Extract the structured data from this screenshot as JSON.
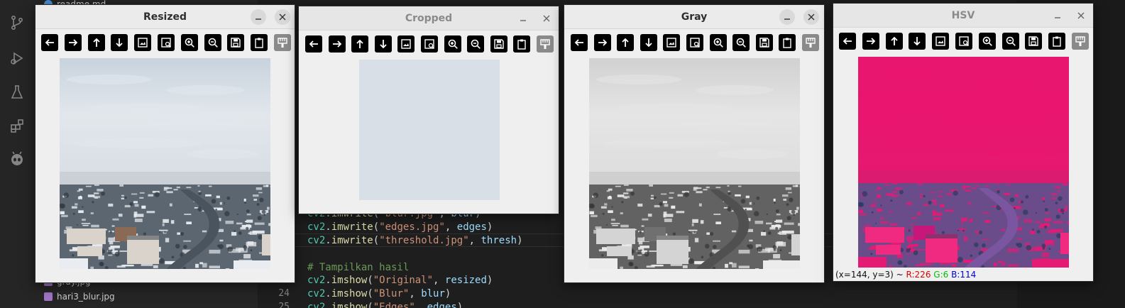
{
  "explorer": {
    "files": [
      {
        "name": "readme.md",
        "type": "md"
      },
      {
        "name": "gray.jpg",
        "type": "image"
      },
      {
        "name": "hari3_blur.jpg",
        "type": "image"
      }
    ]
  },
  "editor": {
    "lines": [
      {
        "number": "",
        "tokens": [
          {
            "t": "cv2",
            "c": "mod"
          },
          {
            "t": ".",
            "c": "pun"
          },
          {
            "t": "imwrite",
            "c": "fn"
          },
          {
            "t": "(",
            "c": "pun"
          },
          {
            "t": "\"blur.jpg\"",
            "c": "str"
          },
          {
            "t": ", ",
            "c": "pun"
          },
          {
            "t": "blur",
            "c": "var"
          },
          {
            "t": ")",
            "c": "pun"
          }
        ]
      },
      {
        "number": "",
        "tokens": [
          {
            "t": "cv2",
            "c": "mod"
          },
          {
            "t": ".",
            "c": "pun"
          },
          {
            "t": "imwrite",
            "c": "fn"
          },
          {
            "t": "(",
            "c": "pun"
          },
          {
            "t": "\"edges.jpg\"",
            "c": "str"
          },
          {
            "t": ", ",
            "c": "pun"
          },
          {
            "t": "edges",
            "c": "var"
          },
          {
            "t": ")",
            "c": "pun"
          }
        ]
      },
      {
        "number": "",
        "tokens": [
          {
            "t": "cv2",
            "c": "mod"
          },
          {
            "t": ".",
            "c": "pun"
          },
          {
            "t": "imwrite",
            "c": "fn"
          },
          {
            "t": "(",
            "c": "pun"
          },
          {
            "t": "\"threshold.jpg\"",
            "c": "str"
          },
          {
            "t": ", ",
            "c": "pun"
          },
          {
            "t": "thresh",
            "c": "var"
          },
          {
            "t": ")",
            "c": "pun"
          }
        ]
      },
      {
        "number": "",
        "tokens": []
      },
      {
        "number": "",
        "tokens": [
          {
            "t": "# Tampilkan hasil",
            "c": "com"
          }
        ]
      },
      {
        "number": "",
        "tokens": [
          {
            "t": "cv2",
            "c": "mod"
          },
          {
            "t": ".",
            "c": "pun"
          },
          {
            "t": "imshow",
            "c": "fn"
          },
          {
            "t": "(",
            "c": "pun"
          },
          {
            "t": "\"Original\"",
            "c": "str"
          },
          {
            "t": ", ",
            "c": "pun"
          },
          {
            "t": "resized",
            "c": "var"
          },
          {
            "t": ")",
            "c": "pun"
          }
        ]
      },
      {
        "number": "24",
        "tokens": [
          {
            "t": "cv2",
            "c": "mod"
          },
          {
            "t": ".",
            "c": "pun"
          },
          {
            "t": "imshow",
            "c": "fn"
          },
          {
            "t": "(",
            "c": "pun"
          },
          {
            "t": "\"Blur\"",
            "c": "str"
          },
          {
            "t": ", ",
            "c": "pun"
          },
          {
            "t": "blur",
            "c": "var"
          },
          {
            "t": ")",
            "c": "pun"
          }
        ]
      },
      {
        "number": "25",
        "tokens": [
          {
            "t": "cv2",
            "c": "mod"
          },
          {
            "t": ".",
            "c": "pun"
          },
          {
            "t": "imshow",
            "c": "fn"
          },
          {
            "t": "(",
            "c": "pun"
          },
          {
            "t": "\"Edges\"",
            "c": "str"
          },
          {
            "t": ", ",
            "c": "pun"
          },
          {
            "t": "edges",
            "c": "var"
          },
          {
            "t": ")",
            "c": "pun"
          }
        ]
      }
    ]
  },
  "toolbar_icons": [
    "arrow-left-icon",
    "arrow-right-icon",
    "arrow-up-icon",
    "arrow-down-icon",
    "zoom-fit-icon",
    "zoom-original-icon",
    "zoom-in-icon",
    "zoom-out-icon",
    "save-icon",
    "copy-clipboard-icon",
    "properties-icon"
  ],
  "windows": [
    {
      "id": "resized",
      "title": "Resized",
      "active": true,
      "image": "color"
    },
    {
      "id": "cropped",
      "title": "Cropped",
      "active": false,
      "image": "crop"
    },
    {
      "id": "gray",
      "title": "Gray",
      "active": true,
      "image": "gray"
    },
    {
      "id": "hsv",
      "title": "HSV",
      "active": false,
      "image": "hsv",
      "status": {
        "coords": "(x=144, y=3) ~ ",
        "r": "R:226",
        "g": "G:6",
        "b": "B:114"
      }
    }
  ],
  "colors": {
    "sky": "#dde3ea",
    "hsv_magenta": "#e8166e",
    "editor_bg": "#1e1e1e",
    "window_bg": "#efefef"
  }
}
